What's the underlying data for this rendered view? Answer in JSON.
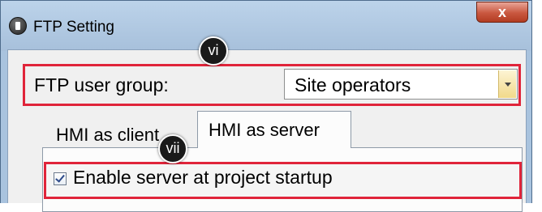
{
  "window": {
    "title": "FTP Setting",
    "close_label": "x"
  },
  "ftp_group": {
    "label": "FTP user group:",
    "selected": "Site operators"
  },
  "tabs": [
    {
      "label": "HMI as client"
    },
    {
      "label": "HMI as server",
      "active": true
    }
  ],
  "server_panel": {
    "enable_label": "Enable server at project startup",
    "enable_checked": true
  },
  "callouts": {
    "vi": "vi",
    "vii": "vii"
  },
  "colors": {
    "highlight": "#e0243a",
    "titlebar": "#a9c3de",
    "close_button": "#c9573f",
    "marker": "#1a1a1a"
  }
}
